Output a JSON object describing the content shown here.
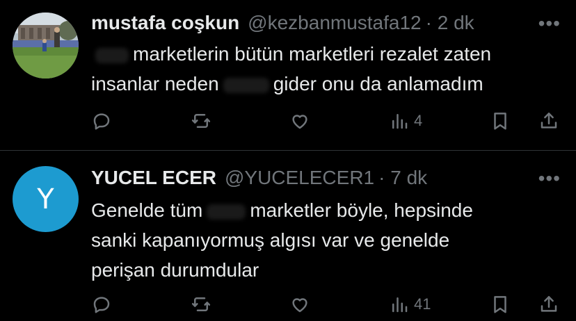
{
  "tweets": [
    {
      "name": "mustafa coşkun",
      "handle": "@kezbanmustafa12",
      "time": "· 2 dk",
      "more": "•••",
      "text_line1": "marketlerin bütün marketleri rezalet zaten",
      "text_line2_a": "insanlar neden",
      "text_line2_b": "gider onu da anlamadım",
      "views": "4"
    },
    {
      "name": "YUCEL ECER",
      "handle": "@YUCELECER1",
      "time": "· 7 dk",
      "more": "•••",
      "avatar_letter": "Y",
      "text_line1_a": "Genelde tüm",
      "text_line1_b": "marketler böyle, hepsinde",
      "text_line2": "sanki kapanıyormuş algısı var ve genelde",
      "text_line3": "perişan durumdular",
      "views": "41"
    }
  ],
  "colors": {
    "background": "#000000",
    "text": "#e7e9ea",
    "muted": "#71767b",
    "avatar": "#1d9bd0"
  },
  "icons": [
    "reply-icon",
    "retweet-icon",
    "like-icon",
    "views-icon",
    "bookmark-icon",
    "share-icon"
  ]
}
